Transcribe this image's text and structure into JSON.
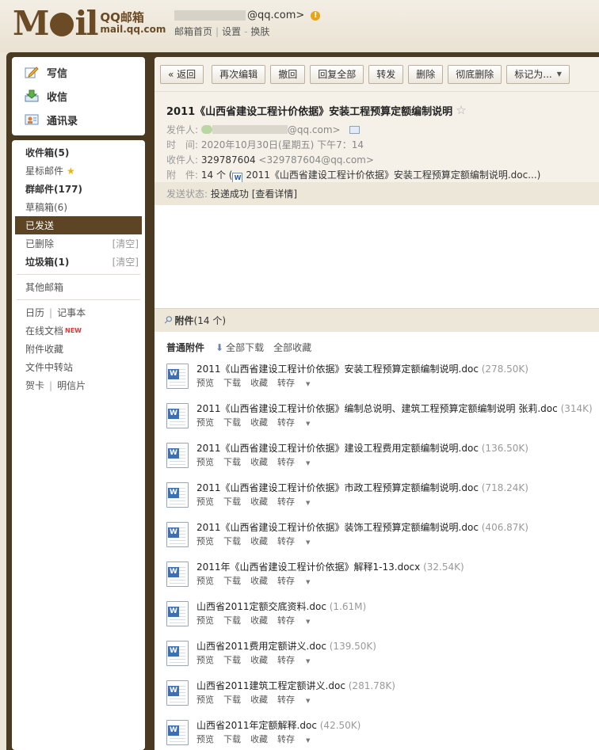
{
  "header": {
    "logo_mark": "M",
    "logo_mark_tail": "il",
    "logo_cn": "QQ邮箱",
    "logo_en": "mail.qq.com",
    "account_suffix": "@qq.com>",
    "links": [
      "邮箱首页",
      "设置",
      "换肤"
    ]
  },
  "sidebar": {
    "actions": [
      {
        "label": "写信",
        "icon": "pencil-icon"
      },
      {
        "label": "收信",
        "icon": "inbox-icon"
      },
      {
        "label": "通讯录",
        "icon": "contacts-icon"
      }
    ],
    "folders": {
      "inbox": "收件箱(5)",
      "starred": "星标邮件",
      "group": "群邮件(177)",
      "drafts": "草稿箱(6)",
      "sent": "已发送",
      "deleted": "已删除",
      "spam": "垃圾箱(1)",
      "clear_label": "[清空]",
      "other": "其他邮箱"
    },
    "tools": {
      "calendar": "日历",
      "notes": "记事本",
      "docs": "在线文档",
      "new_tag": "NEW",
      "favorites": "附件收藏",
      "transfer": "文件中转站",
      "card": "贺卡",
      "postcard": "明信片"
    }
  },
  "toolbar": {
    "back": "« 返回",
    "reedit": "再次编辑",
    "recall": "撤回",
    "reply_all": "回复全部",
    "forward": "转发",
    "delete": "删除",
    "delete_forever": "彻底删除",
    "mark_as": "标记为..."
  },
  "mail": {
    "subject": "2011《山西省建设工程计价依据》安装工程预算定额编制说明",
    "from_label": "发件人:",
    "from_suffix": "@qq.com>",
    "time_label": "时　间:",
    "time_value": "2020年10月30日(星期五) 下午7：14",
    "to_label": "收件人:",
    "to_name": "329787604",
    "to_addr": "<329787604@qq.com>",
    "att_label": "附　件:",
    "att_count": "14 个",
    "att_first": "2011《山西省建设工程计价依据》安装工程预算定额编制说明.doc...)",
    "status_label": "发送状态:",
    "status_value": "投递成功",
    "status_detail": "[查看详情]"
  },
  "attachments": {
    "title": "附件",
    "count": "(14 个)",
    "section_label": "普通附件",
    "download_all": "全部下载",
    "save_all": "全部收藏",
    "ops": [
      "预览",
      "下载",
      "收藏",
      "转存"
    ],
    "items": [
      {
        "name": "2011《山西省建设工程计价依据》安装工程预算定额编制说明.doc",
        "size": "(278.50K)"
      },
      {
        "name": "2011《山西省建设工程计价依据》编制总说明、建筑工程预算定额编制说明 张莉.doc",
        "size": "(314K)"
      },
      {
        "name": "2011《山西省建设工程计价依据》建设工程费用定额编制说明.doc",
        "size": "(136.50K)"
      },
      {
        "name": "2011《山西省建设工程计价依据》市政工程预算定额编制说明.doc",
        "size": "(718.24K)"
      },
      {
        "name": "2011《山西省建设工程计价依据》装饰工程预算定额编制说明.doc",
        "size": "(406.87K)"
      },
      {
        "name": "2011年《山西省建设工程计价依据》解释1-13.docx",
        "size": "(32.54K)"
      },
      {
        "name": "山西省2011定额交底资料.doc",
        "size": "(1.61M)"
      },
      {
        "name": "山西省2011费用定额讲义.doc",
        "size": "(139.50K)"
      },
      {
        "name": "山西省2011建筑工程定额讲义.doc",
        "size": "(281.78K)"
      },
      {
        "name": "山西省2011年定额解释.doc",
        "size": "(42.50K)"
      }
    ]
  }
}
